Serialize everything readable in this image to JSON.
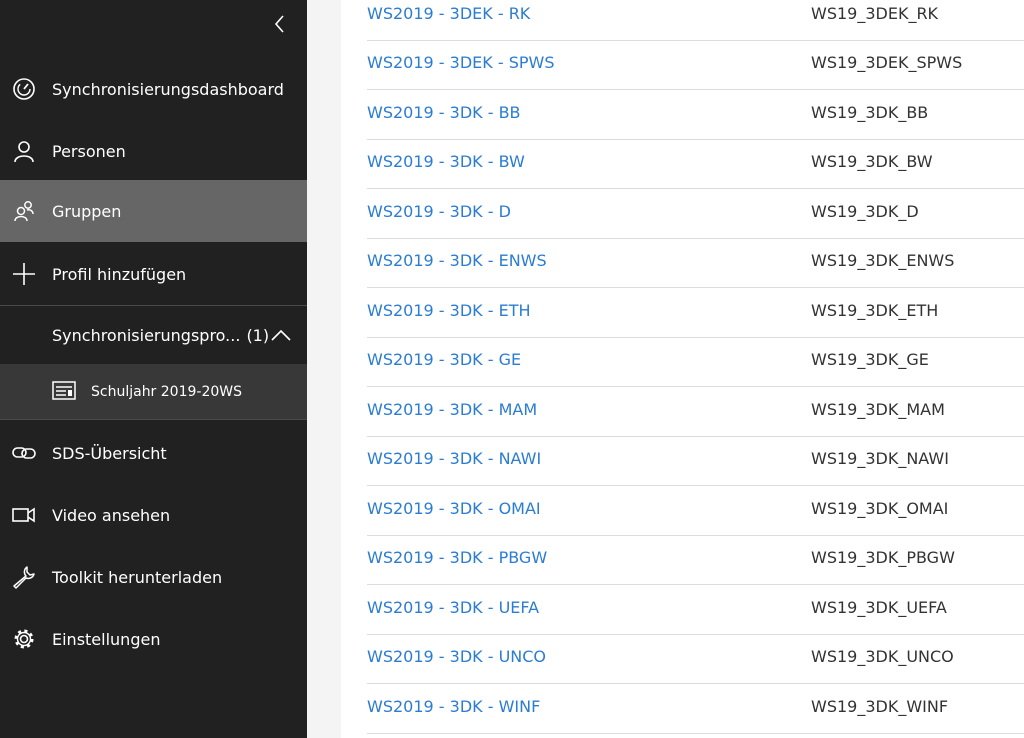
{
  "sidebar": {
    "collapse_icon": "chevron-left-icon",
    "items": [
      {
        "id": "dashboard",
        "label": "Synchronisierungsdashboard",
        "icon": "gauge-icon"
      },
      {
        "id": "personen",
        "label": "Personen",
        "icon": "person-icon"
      },
      {
        "id": "gruppen",
        "label": "Gruppen",
        "icon": "group-icon",
        "active": true
      },
      {
        "id": "profil",
        "label": "Profil hinzufügen",
        "icon": "plus-icon"
      }
    ],
    "sync_profiles": {
      "label": "Synchronisierungspro...",
      "count": "(1)",
      "expanded": true,
      "icon": "chevron-up-icon",
      "items": [
        {
          "label": "Schuljahr 2019-20WS",
          "icon": "profile-card-icon"
        }
      ]
    },
    "bottom_items": [
      {
        "id": "uebersicht",
        "label": "SDS-Übersicht",
        "icon": "link-icon"
      },
      {
        "id": "video",
        "label": "Video ansehen",
        "icon": "video-icon"
      },
      {
        "id": "toolkit",
        "label": "Toolkit herunterladen",
        "icon": "wrench-icon"
      },
      {
        "id": "einstellungen",
        "label": "Einstellungen",
        "icon": "gear-icon"
      }
    ]
  },
  "groups": [
    {
      "name": "WS2019 - 3DEK - RK",
      "nickname": "WS19_3DEK_RK"
    },
    {
      "name": "WS2019 - 3DEK - SPWS",
      "nickname": "WS19_3DEK_SPWS"
    },
    {
      "name": "WS2019 - 3DK - BB",
      "nickname": "WS19_3DK_BB"
    },
    {
      "name": "WS2019 - 3DK - BW",
      "nickname": "WS19_3DK_BW"
    },
    {
      "name": "WS2019 - 3DK - D",
      "nickname": "WS19_3DK_D"
    },
    {
      "name": "WS2019 - 3DK - ENWS",
      "nickname": "WS19_3DK_ENWS"
    },
    {
      "name": "WS2019 - 3DK - ETH",
      "nickname": "WS19_3DK_ETH"
    },
    {
      "name": "WS2019 - 3DK - GE",
      "nickname": "WS19_3DK_GE"
    },
    {
      "name": "WS2019 - 3DK - MAM",
      "nickname": "WS19_3DK_MAM"
    },
    {
      "name": "WS2019 - 3DK - NAWI",
      "nickname": "WS19_3DK_NAWI"
    },
    {
      "name": "WS2019 - 3DK - OMAI",
      "nickname": "WS19_3DK_OMAI"
    },
    {
      "name": "WS2019 - 3DK - PBGW",
      "nickname": "WS19_3DK_PBGW"
    },
    {
      "name": "WS2019 - 3DK - UEFA",
      "nickname": "WS19_3DK_UEFA"
    },
    {
      "name": "WS2019 - 3DK - UNCO",
      "nickname": "WS19_3DK_UNCO"
    },
    {
      "name": "WS2019 - 3DK - WINF",
      "nickname": "WS19_3DK_WINF"
    }
  ],
  "colors": {
    "sidebar_bg": "#212121",
    "active_bg": "#666666",
    "link": "#2b7cd3"
  }
}
